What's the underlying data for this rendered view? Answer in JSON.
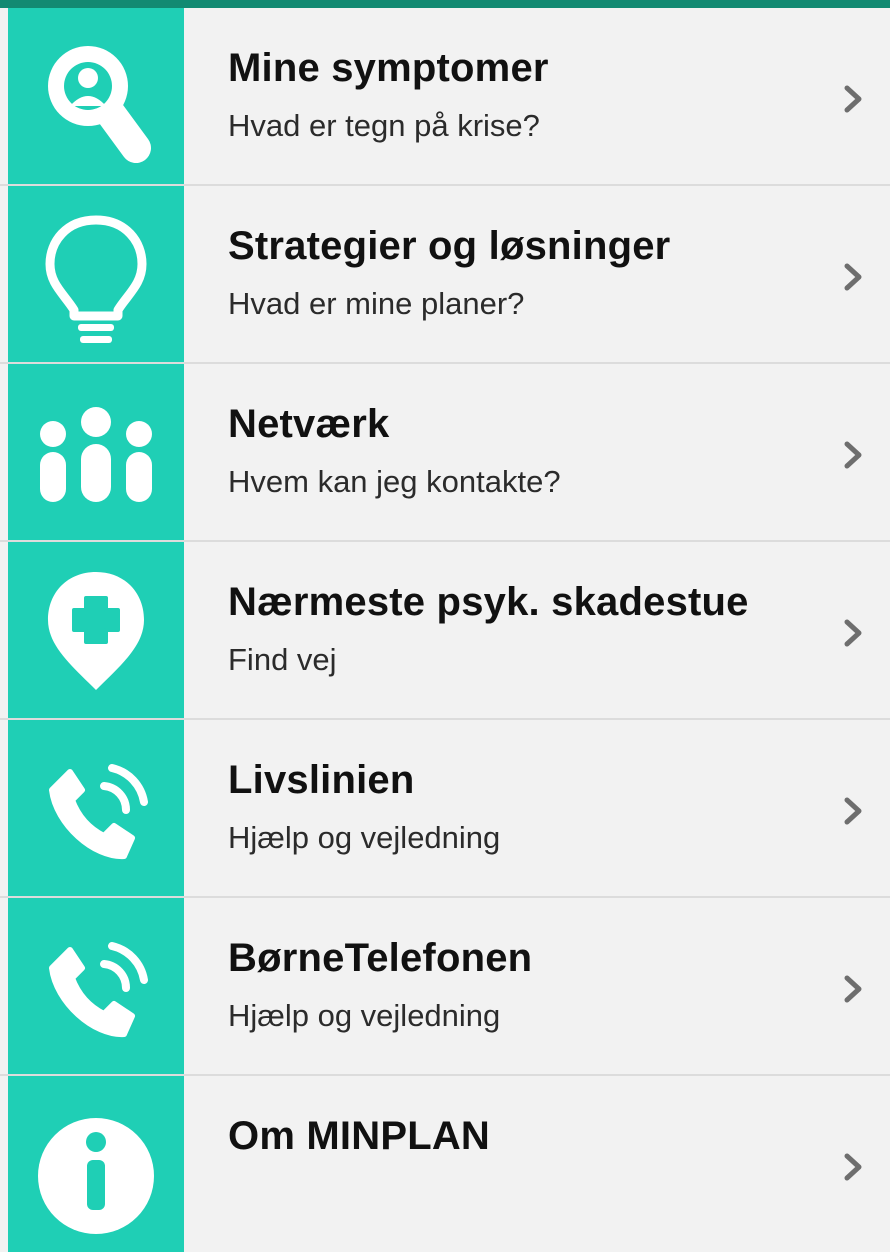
{
  "colors": {
    "accent": "#1fcfb5",
    "topbar": "#128a72",
    "row_bg": "#f2f2f2",
    "divider": "#dcdcdc",
    "chevron": "#6e6e6e"
  },
  "menu": {
    "items": [
      {
        "icon": "symptom-search-icon",
        "title": "Mine symptomer",
        "subtitle": "Hvad er tegn på krise?"
      },
      {
        "icon": "lightbulb-icon",
        "title": "Strategier og løsninger",
        "subtitle": "Hvad er mine planer?"
      },
      {
        "icon": "people-group-icon",
        "title": "Netværk",
        "subtitle": "Hvem kan jeg kontakte?"
      },
      {
        "icon": "map-pin-cross-icon",
        "title": "Nærmeste psyk. skadestue",
        "subtitle": "Find vej"
      },
      {
        "icon": "phone-call-icon",
        "title": "Livslinien",
        "subtitle": "Hjælp og vejledning"
      },
      {
        "icon": "phone-call-icon",
        "title": "BørneTelefonen",
        "subtitle": "Hjælp og vejledning"
      },
      {
        "icon": "info-icon",
        "title": "Om MINPLAN",
        "subtitle": ""
      }
    ]
  }
}
